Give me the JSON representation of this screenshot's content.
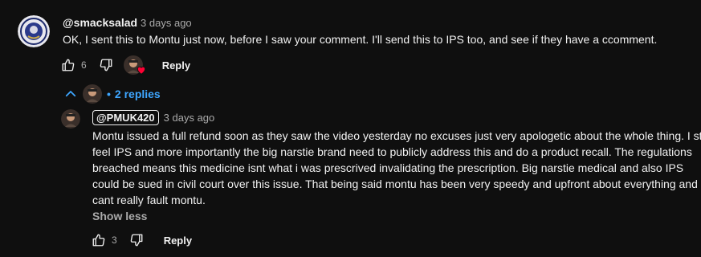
{
  "comment": {
    "author": "@smacksalad",
    "time": "3 days ago",
    "text": "OK, I sent this to Montu just now, before I saw your comment. I'll send this to IPS too, and see if they have a ccomment.",
    "like_count": "6",
    "reply_label": "Reply"
  },
  "replies_toggle": {
    "label": "2 replies",
    "dot": "•"
  },
  "reply": {
    "author": "@PMUK420",
    "time": "3 days ago",
    "text_lines": [
      "Montu issued a full refund soon as they saw the video yesterday no excuses just very apologetic about the whole thing. I still",
      "feel IPS and more importantly the big narstie brand need to publicly address this and do a product recall. The regulations",
      "breached means this medicine isnt what i was prescrived invalidating the prescription. Big narstie medical and also IPS",
      "could be sued in civil court over this issue. That being said montu has been very speedy and upfront about everything and i",
      "cant really fault montu."
    ],
    "show_less_label": "Show less",
    "like_count": "3",
    "reply_label": "Reply"
  },
  "colors": {
    "background": "#0f0f0f",
    "link_blue": "#3ea6ff",
    "heart_red": "#ff0033"
  }
}
